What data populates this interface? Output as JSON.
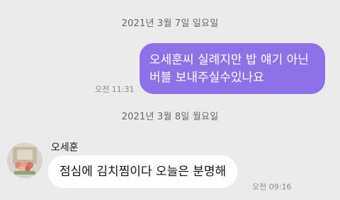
{
  "chat": {
    "messages": [
      {
        "date_divider": "2021년 3월 7일 일요일",
        "direction": "outgoing",
        "lines": [
          "오세훈씨 실례지만 밥 얘기 아닌",
          "버블 보내주실수있나요"
        ],
        "time": "오전 11:31"
      },
      {
        "date_divider": "2021년 3월 8일 월요일",
        "direction": "incoming",
        "sender": "오세훈",
        "text": "점심에 김치찜이다 오늘은 분명해",
        "time": "오전 09:16"
      }
    ]
  },
  "colors": {
    "background": "#ebebeb",
    "outgoing_bubble": "#8c72e6",
    "incoming_bubble": "#ffffff",
    "meta_text": "#8a8a8a"
  }
}
